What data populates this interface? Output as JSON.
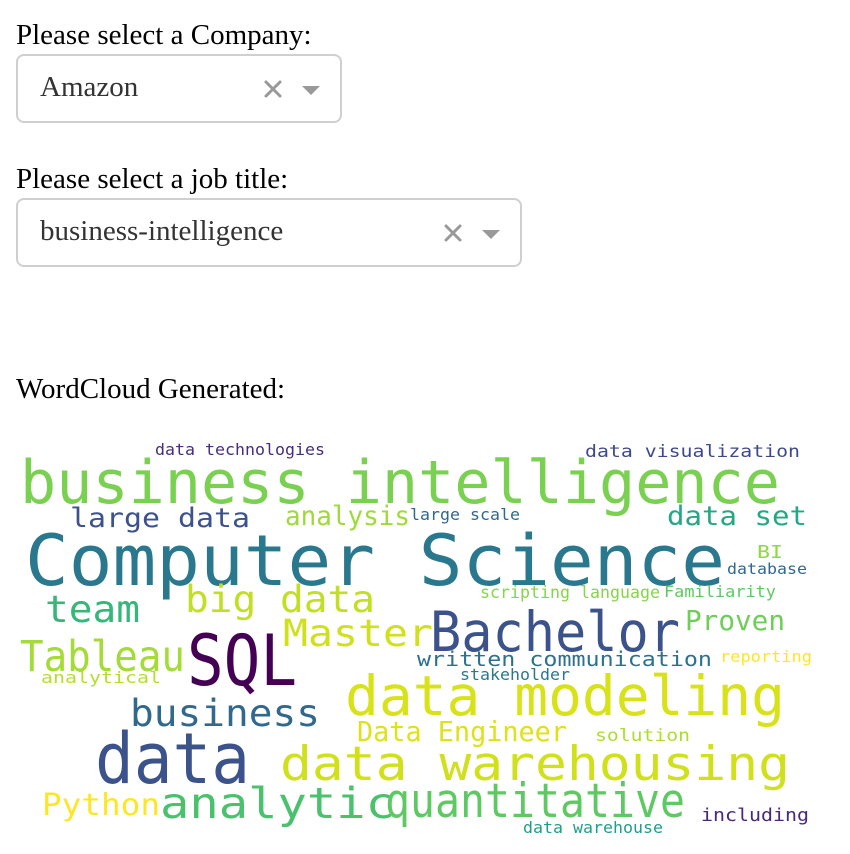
{
  "company": {
    "label": "Please select a Company:",
    "selected": "Amazon"
  },
  "job_title": {
    "label": "Please select a job title:",
    "selected": "business-intelligence"
  },
  "wordcloud": {
    "heading": "WordCloud Generated:",
    "words": [
      {
        "text": "data technologies",
        "color": "#472d7b"
      },
      {
        "text": "data visualization",
        "color": "#3e4989"
      },
      {
        "text": "business intelligence",
        "color": "#7ad151"
      },
      {
        "text": "large data",
        "color": "#3b528b"
      },
      {
        "text": "analysis",
        "color": "#a0da39"
      },
      {
        "text": "large scale",
        "color": "#31688e"
      },
      {
        "text": "data set",
        "color": "#22a884"
      },
      {
        "text": "Computer Science",
        "color": "#2a788e"
      },
      {
        "text": "BI",
        "color": "#90d743"
      },
      {
        "text": "database",
        "color": "#31688e"
      },
      {
        "text": "team",
        "color": "#35b779"
      },
      {
        "text": "big data",
        "color": "#c2df23"
      },
      {
        "text": "scripting language",
        "color": "#86d549"
      },
      {
        "text": "Familiarity",
        "color": "#5ec962"
      },
      {
        "text": "Master",
        "color": "#d0e11c"
      },
      {
        "text": "Bachelor",
        "color": "#3b528b"
      },
      {
        "text": "Proven",
        "color": "#6ece58"
      },
      {
        "text": "Tableau",
        "color": "#a5db36"
      },
      {
        "text": "SQL",
        "color": "#440154"
      },
      {
        "text": "written communication",
        "color": "#2c728e"
      },
      {
        "text": "reporting",
        "color": "#fde725"
      },
      {
        "text": "analytical",
        "color": "#b5de2b"
      },
      {
        "text": "stakeholder",
        "color": "#2a788e"
      },
      {
        "text": "data modeling",
        "color": "#d8e219"
      },
      {
        "text": "business",
        "color": "#31688e"
      },
      {
        "text": "Data Engineer",
        "color": "#dde318"
      },
      {
        "text": "solution",
        "color": "#addc30"
      },
      {
        "text": "data",
        "color": "#3b528b"
      },
      {
        "text": "data warehousing",
        "color": "#d0e11c"
      },
      {
        "text": "Python",
        "color": "#fde725"
      },
      {
        "text": "analytic",
        "color": "#4ac16d"
      },
      {
        "text": "quantitative",
        "color": "#5ec962"
      },
      {
        "text": "including",
        "color": "#482878"
      },
      {
        "text": "data warehouse",
        "color": "#1f9e89"
      }
    ]
  }
}
